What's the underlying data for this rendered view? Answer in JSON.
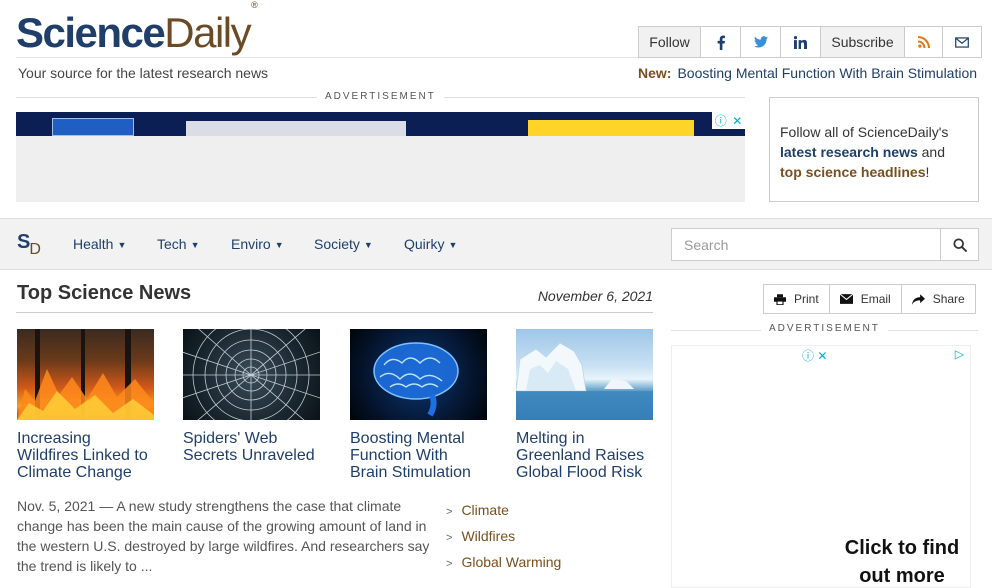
{
  "header": {
    "logo_part1": "Science",
    "logo_part2": "Daily",
    "logo_mark": "®",
    "tagline": "Your source for the latest research news",
    "follow_label": "Follow",
    "subscribe_label": "Subscribe",
    "new_label": "New:",
    "new_text": "Boosting Mental Function With Brain Stimulation"
  },
  "ads": {
    "label": "ADVERTISEMENT",
    "side_cta": "Click to find out more"
  },
  "follow_box": {
    "line1": "Follow all of ScienceDaily's",
    "link1": "latest research news",
    "and": " and",
    "link2": "top science headlines",
    "bang": "!"
  },
  "nav": {
    "mark_s": "S",
    "mark_d": "D",
    "items": [
      "Health",
      "Tech",
      "Enviro",
      "Society",
      "Quirky"
    ],
    "search_placeholder": "Search"
  },
  "main": {
    "section_title": "Top Science News",
    "date": "November 6, 2021",
    "stories": [
      {
        "title": "Increasing Wildfires Linked to Climate Change",
        "thumb": "wildfire"
      },
      {
        "title": "Spiders' Web Secrets Unraveled",
        "thumb": "spider-web"
      },
      {
        "title": "Boosting Mental Function With Brain Stimulation",
        "thumb": "brain"
      },
      {
        "title": "Melting in Greenland Raises Global Flood Risk",
        "thumb": "iceberg"
      }
    ],
    "summary": "Nov. 5, 2021 — A new study strengthens the case that climate change has been the main cause of the growing amount of land in the western U.S. destroyed by large wildfires. And researchers say the trend is likely to ...",
    "tags": [
      "Climate",
      "Wildfires",
      "Global Warming"
    ]
  },
  "share": {
    "print": "Print",
    "email": "Email",
    "share": "Share"
  },
  "colors": {
    "brand_blue": "#1f3f6a",
    "brand_brown": "#6b4a26",
    "rss_orange": "#d9791a",
    "ad_info": "#00aecd"
  }
}
